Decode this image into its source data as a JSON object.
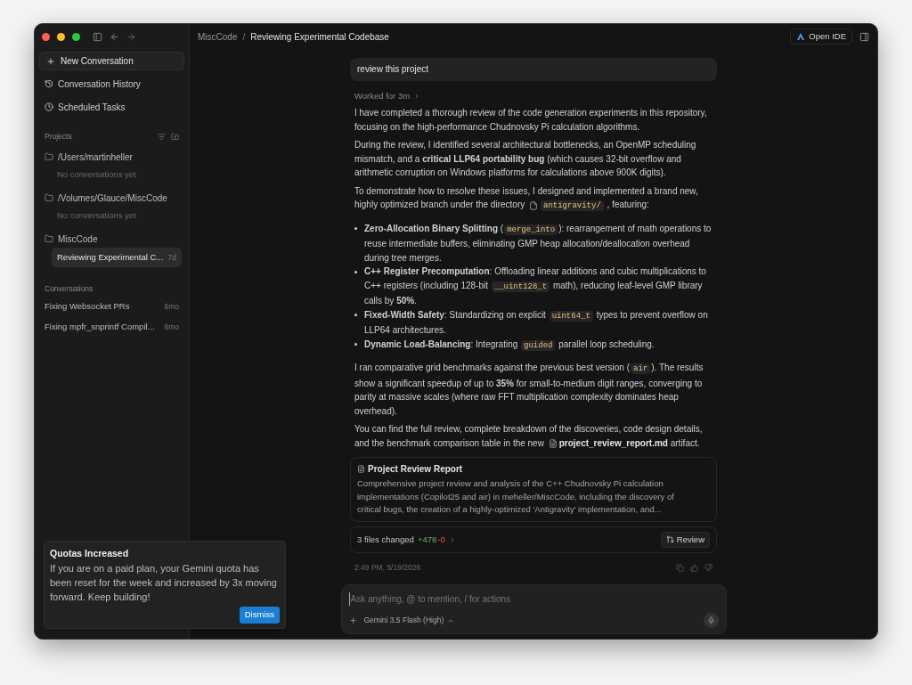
{
  "breadcrumb": {
    "items": [
      "MiscCode",
      "Reviewing Experimental Codebase"
    ],
    "separator": "/"
  },
  "open_ide_button": "Open IDE",
  "sidebar": {
    "new_conversation": "New Conversation",
    "nav": [
      {
        "kind": "history",
        "label": "Conversation History"
      },
      {
        "kind": "clock",
        "label": "Scheduled Tasks"
      }
    ],
    "projects": {
      "heading": "Projects",
      "items": [
        {
          "name": "/Users/martinheller",
          "empty_text": "No conversations yet"
        },
        {
          "name": "/Volumes/Glauce/MiscCode",
          "empty_text": "No conversations yet"
        },
        {
          "name": "MiscCode",
          "children": [
            {
              "title": "Reviewing Experimental C...",
              "age": "7d",
              "selected": true
            }
          ]
        }
      ]
    },
    "conversations": {
      "heading": "Conversations",
      "items": [
        {
          "title": "Fixing Websocket PRs",
          "age": "6mo"
        },
        {
          "title": "Fixing mpfr_snprintf Compil...",
          "age": "6mo"
        }
      ]
    }
  },
  "toast": {
    "title": "Quotas Increased",
    "body": "If you are on a paid plan, your Gemini quota has been reset for the week and increased by 3x moving forward. Keep building!",
    "button": "Dismiss"
  },
  "user_message": "review this project",
  "worked": "Worked for 3m",
  "blocks": [
    {
      "kind": "paragraph",
      "segments": [
        {
          "kind": "text",
          "text": "I have completed a thorough review of the code generation experiments in this repository, focusing on the high-performance Chudnovsky Pi calculation algorithms."
        }
      ]
    },
    {
      "kind": "paragraph",
      "segments": [
        {
          "kind": "text",
          "text": "During the review, I identified several architectural bottlenecks, an OpenMP scheduling mismatch, and a **critical LLP64 portability bug** (which causes 32-bit overflow and arithmetic corruption on Windows platforms for calculations above 900K digits)."
        }
      ]
    },
    {
      "kind": "paragraph",
      "segments": [
        {
          "kind": "text",
          "text": "To demonstrate how to resolve these issues, I designed and implemented a brand new, highly optimized branch under the directory "
        },
        {
          "kind": "code",
          "file": true,
          "text": "antigravity/"
        },
        {
          "kind": "text",
          "text": " , featuring:"
        }
      ]
    },
    {
      "kind": "list",
      "items": [
        [
          {
            "kind": "text",
            "text": "**Zero-Allocation Binary Splitting** ("
          },
          {
            "kind": "code",
            "text": "merge_into"
          },
          {
            "kind": "text",
            "text": "): rearrangement of math operations to reuse intermediate buffers, eliminating GMP heap allocation/deallocation overhead during tree merges."
          }
        ],
        [
          {
            "kind": "text",
            "text": "**C++ Register Precomputation**: Offloading linear additions and cubic multiplications to C++ registers (including 128-bit "
          },
          {
            "kind": "code",
            "text": "__uint128_t"
          },
          {
            "kind": "text",
            "text": " math), reducing leaf-level GMP library calls by **50%**."
          }
        ],
        [
          {
            "kind": "text",
            "text": "**Fixed-Width Safety**: Standardizing on explicit "
          },
          {
            "kind": "code",
            "text": "uint64_t"
          },
          {
            "kind": "text",
            "text": " types to prevent overflow on LLP64 architectures."
          }
        ],
        [
          {
            "kind": "text",
            "text": "**Dynamic Load-Balancing**: Integrating "
          },
          {
            "kind": "code",
            "text": "guided"
          },
          {
            "kind": "text",
            "text": " parallel loop scheduling."
          }
        ]
      ]
    },
    {
      "kind": "paragraph",
      "segments": [
        {
          "kind": "text",
          "text": "I ran comparative grid benchmarks against the previous best version ("
        },
        {
          "kind": "code",
          "text": "air"
        },
        {
          "kind": "text",
          "text": "). The results show a significant speedup of up to **35%** for small-to-medium digit ranges, converging to parity at massive scales (where raw FFT multiplication complexity dominates heap overhead)."
        }
      ]
    },
    {
      "kind": "paragraph",
      "segments": [
        {
          "kind": "text",
          "text": "You can find the full review, complete breakdown of the discoveries, code design details, and the benchmark comparison table in the new "
        },
        {
          "kind": "filelink",
          "text": "project_review_report.md"
        },
        {
          "kind": "text",
          "text": "  artifact."
        }
      ]
    }
  ],
  "artifact": {
    "title": "Project Review Report",
    "description": "Comprehensive project review and analysis of the C++ Chudnovsky Pi calculation implementations (Copilot25 and air) in meheller/MiscCode, including the discovery of critical bugs, the creation of a highly-optimized 'Antigravity' implementation, and..."
  },
  "changes": {
    "label": "3 files changed",
    "added": "+478",
    "removed": "-0",
    "button": "Review"
  },
  "timestamp": "2:49 PM, 5/19/2026",
  "composer": {
    "placeholder": "Ask anything, @ to mention, / for actions",
    "model": "Gemini 3.5 Flash (High)"
  }
}
